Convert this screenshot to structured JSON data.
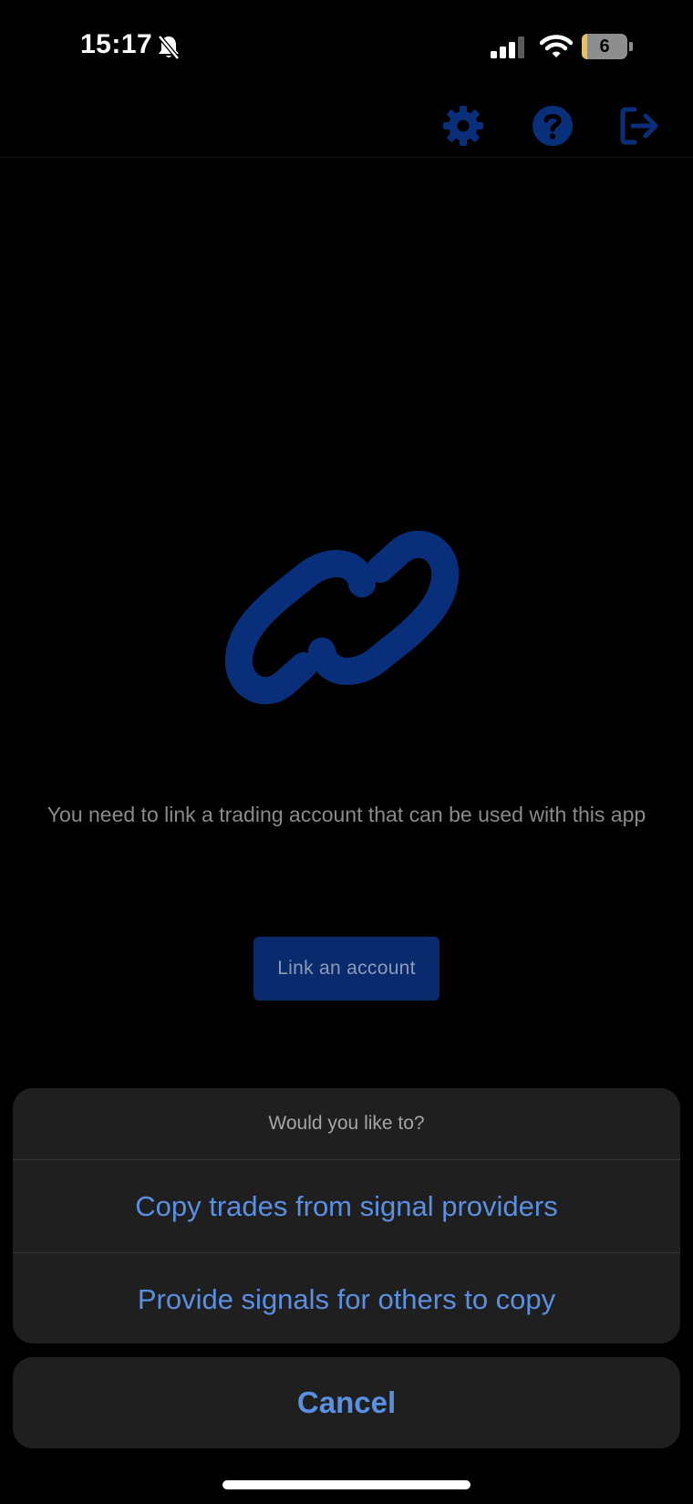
{
  "status_bar": {
    "time": "15:17",
    "battery_level": "6",
    "icons": [
      "bell-slash-icon",
      "cellular-signal-icon",
      "wifi-icon",
      "battery-icon"
    ]
  },
  "header": {
    "actions": [
      "gear-icon",
      "help-icon",
      "logout-icon"
    ],
    "icon_color": "#0a2f7a"
  },
  "main": {
    "illustration": "link-icon",
    "message": "You need to link a trading account that can be used with this app",
    "link_button_label": "Link an account",
    "accent_color": "#0a2a6e"
  },
  "action_sheet": {
    "title": "Would you like to?",
    "options": [
      "Copy trades from signal providers",
      "Provide signals for others to copy"
    ],
    "cancel_label": "Cancel",
    "option_color": "#5b8fe2"
  }
}
